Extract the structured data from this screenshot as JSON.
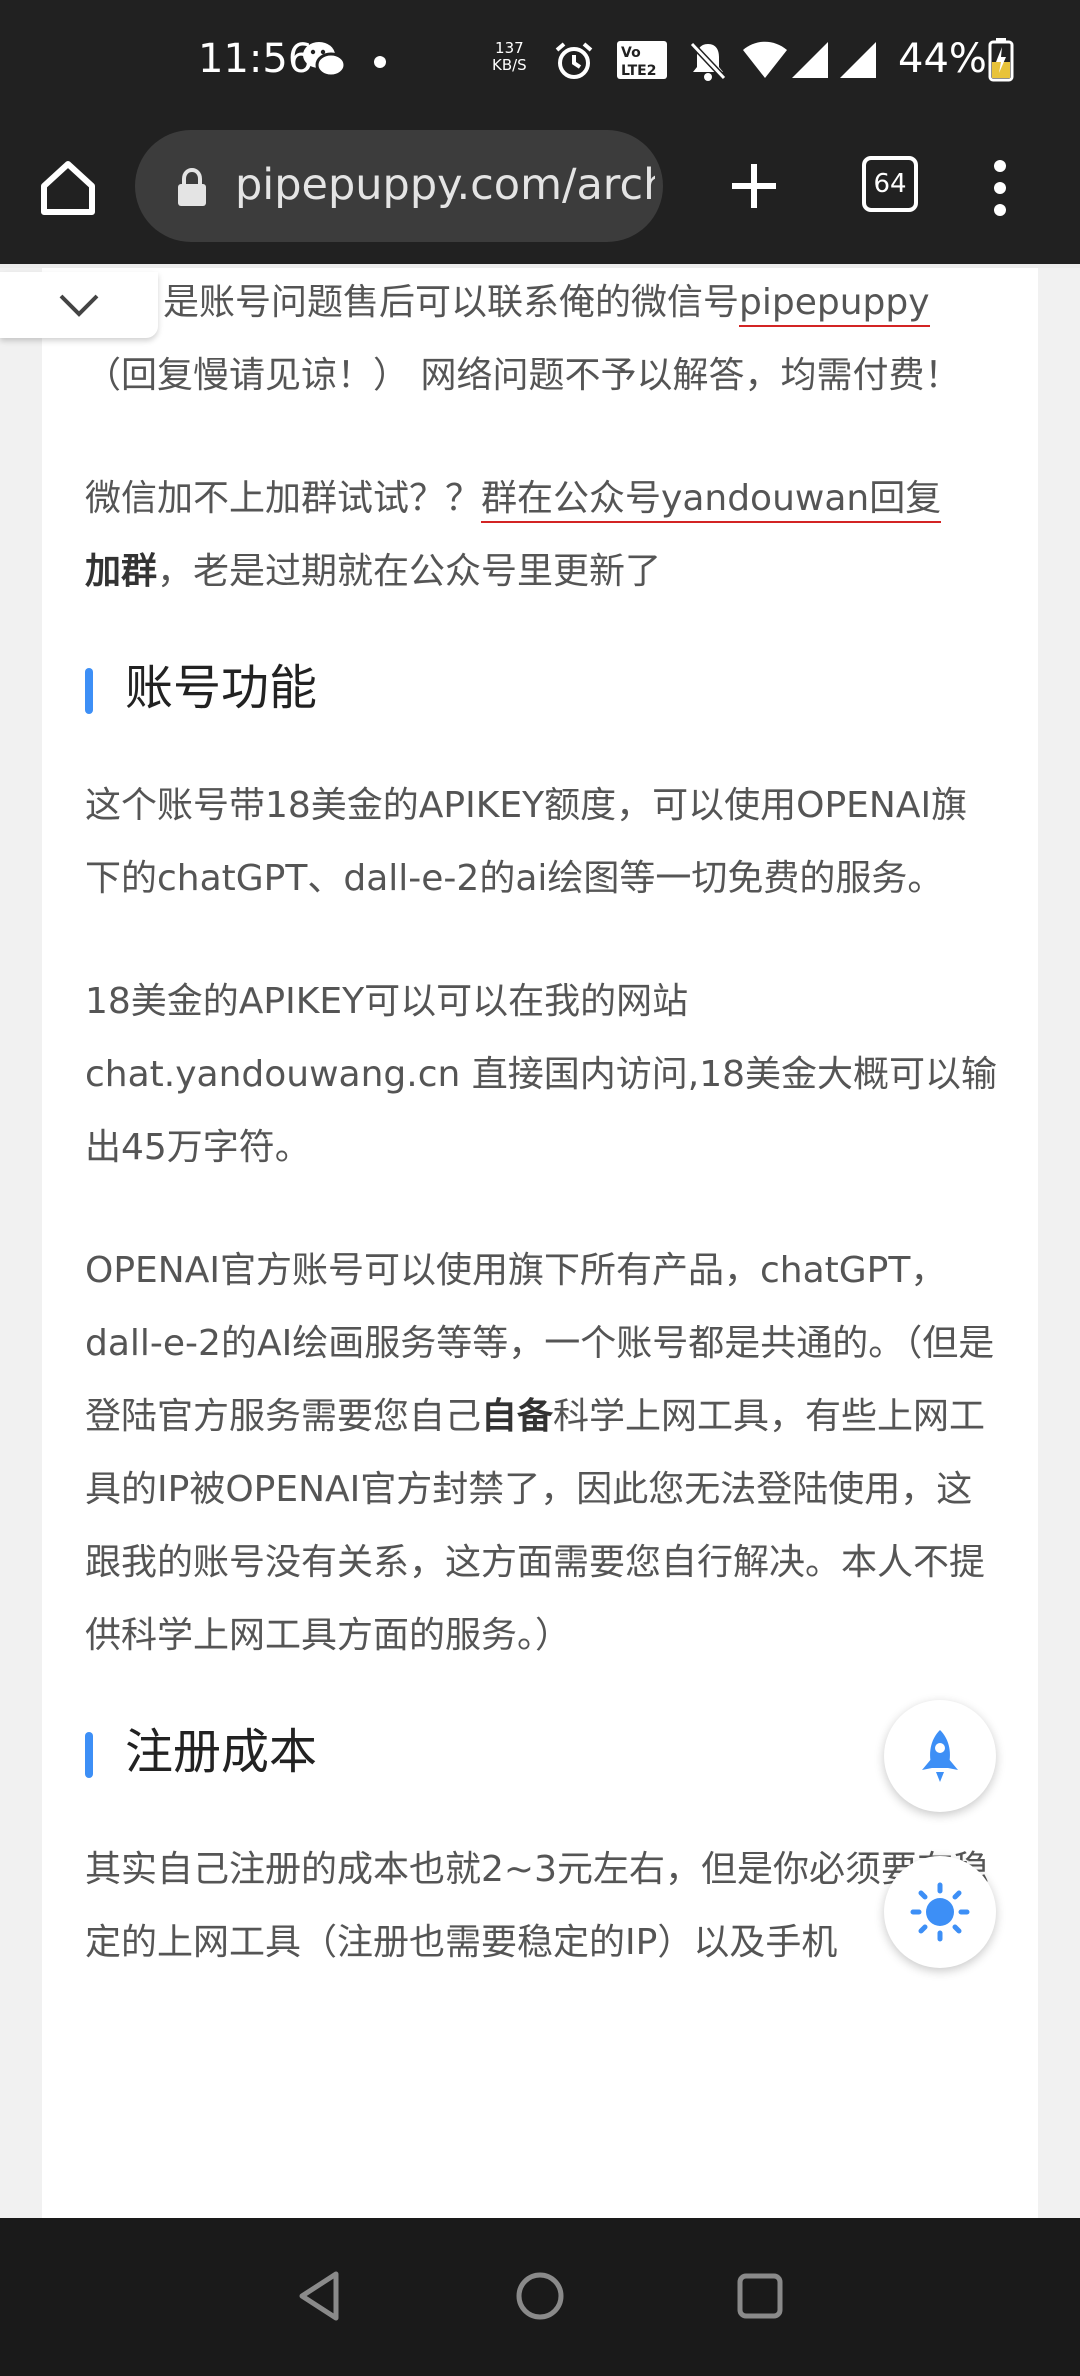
{
  "status_bar": {
    "time": "11:56",
    "net_speed_value": "137",
    "net_speed_unit": "KB/S",
    "battery": "44%",
    "icons": [
      "wechat-icon",
      "notification-dot-icon",
      "alarm-icon",
      "volte-icon",
      "mute-icon",
      "wifi-icon",
      "signal-icon",
      "signal-icon",
      "battery-charging-icon"
    ]
  },
  "browser": {
    "url": "pipepuppy.com/archives",
    "tab_count": "64",
    "icons": [
      "home-icon",
      "lock-icon",
      "plus-icon",
      "tabs-icon",
      "more-vert-icon"
    ]
  },
  "article": {
    "p1_line1": "是账号问题售后可以联系俺的微信号",
    "p1_wechat": "pipepuppy",
    "p1_rest": "（回复慢请见谅！） 网络问题不予以解答，均需付费！",
    "p2_pre": "微信加不上加群试试？？",
    "p2_link": "群在公众号yandouwan回复",
    "p2_bold": "加群",
    "p2_rest": "，老是过期就在公众号里更新了",
    "h_features": "账号功能",
    "p3": "这个账号带18美金的APIKEY额度，可以使用OPENAI旗下的chatGPT、dall-e-2的ai绘图等一切免费的服务。",
    "p4": "18美金的APIKEY可以可以在我的网站chat.yandouwang.cn 直接国内访问,18美金大概可以输出45万字符。",
    "p5_pre": "OPENAI官方账号可以使用旗下所有产品，chatGPT，dall-e-2的AI绘画服务等等，一个账号都是共通的。（但是登陆官方服务需要您自己",
    "p5_bold": "自备",
    "p5_rest": "科学上网工具，有些上网工具的IP被OPENAI官方封禁了，因此您无法登陆使用，这跟我的账号没有关系，这方面需要您自行解决。本人不提供科学上网工具方面的服务。）",
    "h_cost": "注册成本",
    "p6": "其实自己注册的成本也就2~3元左右，但是你必须要有稳定的上网工具（注册也需要稳定的IP）以及手机"
  },
  "floating": {
    "icons": [
      "rocket-icon",
      "sun-icon"
    ]
  },
  "navbar": {
    "icons": [
      "back-triangle-icon",
      "home-circle-icon",
      "recents-square-icon"
    ]
  }
}
